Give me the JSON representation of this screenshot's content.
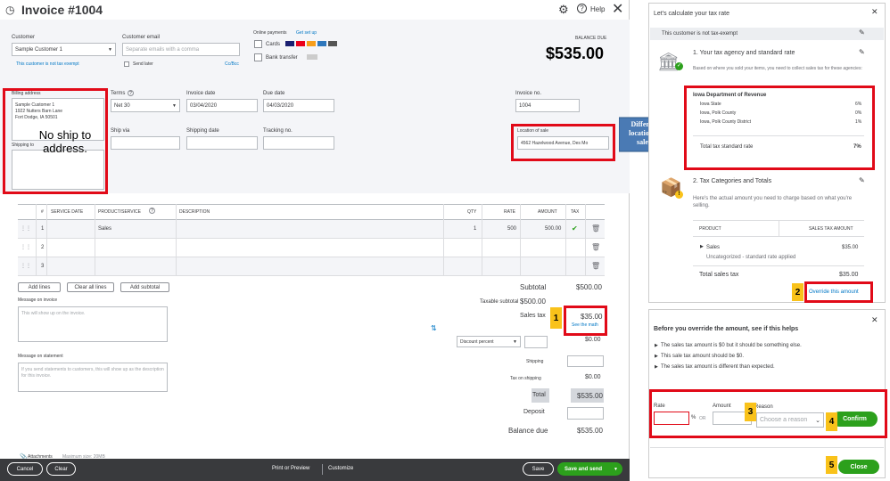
{
  "header": {
    "title": "Invoice #1004",
    "help": "Help",
    "balance_label": "BALANCE DUE",
    "balance": "$535.00"
  },
  "customer": {
    "label": "Customer",
    "value": "Sample Customer 1",
    "not_tax_exempt": "This customer is not tax exempt"
  },
  "email": {
    "label": "Customer email",
    "placeholder": "Separate emails with a comma",
    "send_later": "Send later",
    "cc_bcc": "Cc/Bcc"
  },
  "online_payments": {
    "label": "Online payments",
    "get_set_up": "Get set up",
    "cards": "Cards",
    "bank_transfer": "Bank transfer"
  },
  "billing": {
    "label": "Billing address",
    "lines": [
      "Sample Customer 1",
      "1922 Nutters Barn Lane",
      "Fort Dodge, IA 50501"
    ],
    "shipping_label": "Shipping to"
  },
  "terms": {
    "label": "Terms",
    "value": "Net 30"
  },
  "invoice_date": {
    "label": "Invoice date",
    "value": "03/04/2020"
  },
  "due_date": {
    "label": "Due date",
    "value": "04/03/2020"
  },
  "invoice_no": {
    "label": "Invoice no.",
    "value": "1004"
  },
  "ship_via": {
    "label": "Ship via"
  },
  "shipping_date": {
    "label": "Shipping date"
  },
  "tracking": {
    "label": "Tracking no."
  },
  "location": {
    "label": "Location of sale",
    "value": "4562 Hazelwood Avenue, Des Mo"
  },
  "notes": {
    "no_ship": "No ship to address.",
    "different_location": "Different location of sales."
  },
  "table": {
    "headers": {
      "num": "#",
      "service_date": "SERVICE DATE",
      "product": "PRODUCT/SERVICE",
      "description": "DESCRIPTION",
      "qty": "QTY",
      "rate": "RATE",
      "amount": "AMOUNT",
      "tax": "TAX"
    },
    "rows": [
      {
        "num": "1",
        "product": "Sales",
        "qty": "1",
        "rate": "500",
        "amount": "500.00"
      },
      {
        "num": "2"
      },
      {
        "num": "3"
      }
    ]
  },
  "line_buttons": {
    "add_lines": "Add lines",
    "clear_all": "Clear all lines",
    "add_subtotal": "Add subtotal"
  },
  "message_invoice": {
    "label": "Message on invoice",
    "placeholder": "This will show up on the invoice."
  },
  "message_statement": {
    "label": "Message on statement",
    "placeholder": "If you send statements to customers, this will show up as the description for this invoice."
  },
  "totals": {
    "subtotal_label": "Subtotal",
    "subtotal": "$500.00",
    "taxable_label": "Taxable subtotal",
    "taxable": "$500.00",
    "sales_tax_label": "Sales tax",
    "sales_tax": "$35.00",
    "see_math": "See the math",
    "discount": "Discount percent",
    "discount_amount": "$0.00",
    "shipping_label": "Shipping",
    "tax_shipping_label": "Tax on shipping",
    "tax_shipping": "$0.00",
    "total_label": "Total",
    "total": "$535.00",
    "deposit_label": "Deposit",
    "balance_due_label": "Balance due",
    "balance_due": "$535.00"
  },
  "attachments": {
    "label": "Attachments",
    "max": "Maximum size: 20MB"
  },
  "footer": {
    "cancel": "Cancel",
    "clear": "Clear",
    "print": "Print or Preview",
    "customize": "Customize",
    "save": "Save",
    "save_send": "Save and send"
  },
  "panel": {
    "title": "Let's calculate your tax rate",
    "not_exempt": "This customer is not tax-exempt",
    "sec1_title": "1. Your tax agency and standard rate",
    "sec1_desc": "Based on where you sold your items, you need to collect sales tax for these agencies:",
    "agency": "Iowa Department of Revenue",
    "rates": [
      {
        "name": "Iowa State",
        "rate": "6%"
      },
      {
        "name": "Iowa, Polk County",
        "rate": "0%"
      },
      {
        "name": "Iowa, Polk County District",
        "rate": "1%"
      }
    ],
    "total_rate_label": "Total tax standard rate",
    "total_rate": "7%",
    "sec2_title": "2. Tax Categories and Totals",
    "sec2_desc": "Here's the actual amount you need to charge based on what you're selling.",
    "col_product": "PRODUCT",
    "col_amount": "SALES TAX AMOUNT",
    "product": "Sales",
    "product_amount": "$35.00",
    "product_sub": "Uncategorized - standard rate applied",
    "total_sales_tax_label": "Total sales tax",
    "total_sales_tax": "$35.00",
    "override": "Override this amount",
    "override_title": "Before you override the amount, see if this helps",
    "helps": [
      "The sales tax amount is $0 but it should be something else.",
      "This sale tax amount should be $0.",
      "The sales tax amount is different than expected."
    ],
    "rate_label": "Rate",
    "pct": "%",
    "or": "OR",
    "amount_label": "Amount",
    "reason_label": "Reason",
    "reason_placeholder": "Choose a reason",
    "confirm": "Confirm",
    "close": "Close"
  },
  "badges": {
    "b1": "1",
    "b2": "2",
    "b3": "3",
    "b4": "4",
    "b5": "5"
  }
}
